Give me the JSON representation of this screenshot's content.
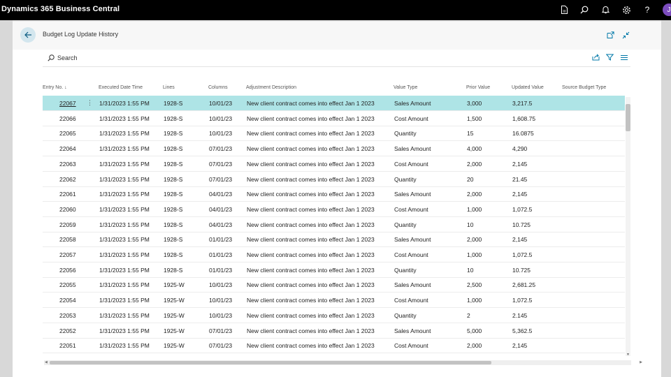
{
  "app": {
    "title": "Dynamics 365 Business Central",
    "avatar_initial": "J"
  },
  "page": {
    "title": "Budget Log Update History"
  },
  "toolbar": {
    "search_label": "Search"
  },
  "columns": [
    {
      "key": "entry_no",
      "label": "Entry No. ↓"
    },
    {
      "key": "executed",
      "label": "Executed Date Time"
    },
    {
      "key": "lines",
      "label": "Lines"
    },
    {
      "key": "columns",
      "label": "Columns"
    },
    {
      "key": "description",
      "label": "Adjustment Description"
    },
    {
      "key": "value_type",
      "label": "Value Type"
    },
    {
      "key": "prior",
      "label": "Prior Value"
    },
    {
      "key": "updated",
      "label": "Updated Value"
    },
    {
      "key": "source",
      "label": "Source Budget Type"
    }
  ],
  "rows": [
    {
      "entry_no": "22067",
      "executed": "1/31/2023 1:55 PM",
      "lines": "1928-S",
      "columns": "10/01/23",
      "description": "New client contract comes into effect Jan 1 2023",
      "value_type": "Sales Amount",
      "prior": "3,000",
      "updated": "3,217.5",
      "source": ""
    },
    {
      "entry_no": "22066",
      "executed": "1/31/2023 1:55 PM",
      "lines": "1928-S",
      "columns": "10/01/23",
      "description": "New client contract comes into effect Jan 1 2023",
      "value_type": "Cost Amount",
      "prior": "1,500",
      "updated": "1,608.75",
      "source": ""
    },
    {
      "entry_no": "22065",
      "executed": "1/31/2023 1:55 PM",
      "lines": "1928-S",
      "columns": "10/01/23",
      "description": "New client contract comes into effect Jan 1 2023",
      "value_type": "Quantity",
      "prior": "15",
      "updated": "16.0875",
      "source": ""
    },
    {
      "entry_no": "22064",
      "executed": "1/31/2023 1:55 PM",
      "lines": "1928-S",
      "columns": "07/01/23",
      "description": "New client contract comes into effect Jan 1 2023",
      "value_type": "Sales Amount",
      "prior": "4,000",
      "updated": "4,290",
      "source": ""
    },
    {
      "entry_no": "22063",
      "executed": "1/31/2023 1:55 PM",
      "lines": "1928-S",
      "columns": "07/01/23",
      "description": "New client contract comes into effect Jan 1 2023",
      "value_type": "Cost Amount",
      "prior": "2,000",
      "updated": "2,145",
      "source": ""
    },
    {
      "entry_no": "22062",
      "executed": "1/31/2023 1:55 PM",
      "lines": "1928-S",
      "columns": "07/01/23",
      "description": "New client contract comes into effect Jan 1 2023",
      "value_type": "Quantity",
      "prior": "20",
      "updated": "21.45",
      "source": ""
    },
    {
      "entry_no": "22061",
      "executed": "1/31/2023 1:55 PM",
      "lines": "1928-S",
      "columns": "04/01/23",
      "description": "New client contract comes into effect Jan 1 2023",
      "value_type": "Sales Amount",
      "prior": "2,000",
      "updated": "2,145",
      "source": ""
    },
    {
      "entry_no": "22060",
      "executed": "1/31/2023 1:55 PM",
      "lines": "1928-S",
      "columns": "04/01/23",
      "description": "New client contract comes into effect Jan 1 2023",
      "value_type": "Cost Amount",
      "prior": "1,000",
      "updated": "1,072.5",
      "source": ""
    },
    {
      "entry_no": "22059",
      "executed": "1/31/2023 1:55 PM",
      "lines": "1928-S",
      "columns": "04/01/23",
      "description": "New client contract comes into effect Jan 1 2023",
      "value_type": "Quantity",
      "prior": "10",
      "updated": "10.725",
      "source": ""
    },
    {
      "entry_no": "22058",
      "executed": "1/31/2023 1:55 PM",
      "lines": "1928-S",
      "columns": "01/01/23",
      "description": "New client contract comes into effect Jan 1 2023",
      "value_type": "Sales Amount",
      "prior": "2,000",
      "updated": "2,145",
      "source": ""
    },
    {
      "entry_no": "22057",
      "executed": "1/31/2023 1:55 PM",
      "lines": "1928-S",
      "columns": "01/01/23",
      "description": "New client contract comes into effect Jan 1 2023",
      "value_type": "Cost Amount",
      "prior": "1,000",
      "updated": "1,072.5",
      "source": ""
    },
    {
      "entry_no": "22056",
      "executed": "1/31/2023 1:55 PM",
      "lines": "1928-S",
      "columns": "01/01/23",
      "description": "New client contract comes into effect Jan 1 2023",
      "value_type": "Quantity",
      "prior": "10",
      "updated": "10.725",
      "source": ""
    },
    {
      "entry_no": "22055",
      "executed": "1/31/2023 1:55 PM",
      "lines": "1925-W",
      "columns": "10/01/23",
      "description": "New client contract comes into effect Jan 1 2023",
      "value_type": "Sales Amount",
      "prior": "2,500",
      "updated": "2,681.25",
      "source": ""
    },
    {
      "entry_no": "22054",
      "executed": "1/31/2023 1:55 PM",
      "lines": "1925-W",
      "columns": "10/01/23",
      "description": "New client contract comes into effect Jan 1 2023",
      "value_type": "Cost Amount",
      "prior": "1,000",
      "updated": "1,072.5",
      "source": ""
    },
    {
      "entry_no": "22053",
      "executed": "1/31/2023 1:55 PM",
      "lines": "1925-W",
      "columns": "10/01/23",
      "description": "New client contract comes into effect Jan 1 2023",
      "value_type": "Quantity",
      "prior": "2",
      "updated": "2.145",
      "source": ""
    },
    {
      "entry_no": "22052",
      "executed": "1/31/2023 1:55 PM",
      "lines": "1925-W",
      "columns": "07/01/23",
      "description": "New client contract comes into effect Jan 1 2023",
      "value_type": "Sales Amount",
      "prior": "5,000",
      "updated": "5,362.5",
      "source": ""
    },
    {
      "entry_no": "22051",
      "executed": "1/31/2023 1:55 PM",
      "lines": "1925-W",
      "columns": "07/01/23",
      "description": "New client contract comes into effect Jan 1 2023",
      "value_type": "Cost Amount",
      "prior": "2,000",
      "updated": "2,145",
      "source": ""
    }
  ],
  "selected_row": 0,
  "colors": {
    "topbar": "#000000",
    "selected_row": "#aee4e6",
    "back_button": "#d3e6ee",
    "accent": "#0078a8",
    "avatar": "#7c4dbe"
  },
  "icons": {
    "topbar": [
      "document-icon",
      "search-icon",
      "bell-icon",
      "gear-icon",
      "help-icon"
    ],
    "header": [
      "open-in-new-window-icon",
      "collapse-icon"
    ],
    "actions": [
      "share-icon",
      "filter-icon",
      "list-view-icon"
    ]
  }
}
